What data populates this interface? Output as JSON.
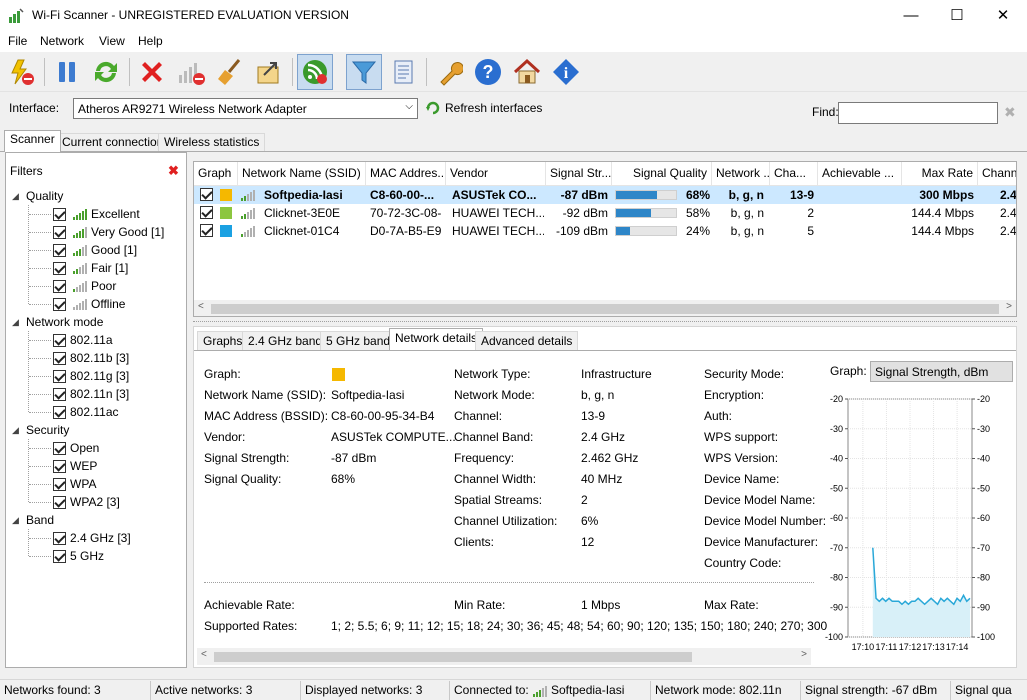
{
  "window": {
    "title": "Wi-Fi Scanner - UNREGISTERED EVALUATION VERSION",
    "min": "—",
    "max": "☐",
    "close": "✕"
  },
  "menu": [
    "File",
    "Network",
    "View",
    "Help"
  ],
  "toolbar": {
    "icons": [
      "power-off-icon",
      "pause-icon",
      "refresh-icon",
      "delete-icon",
      "signal-off-icon",
      "broom-icon",
      "export-icon",
      "rss-icon",
      "filter-icon",
      "notebook-icon",
      "wrench-icon",
      "help-icon",
      "home-icon",
      "info-icon"
    ],
    "active": [
      "rss-icon",
      "filter-icon"
    ]
  },
  "interface": {
    "label": "Interface:",
    "value": "Atheros AR9271 Wireless Network Adapter",
    "refresh": "Refresh interfaces",
    "find_label": "Find:",
    "find_value": ""
  },
  "tabs": [
    "Scanner",
    "Current connection",
    "Wireless statistics"
  ],
  "filters": {
    "title": "Filters",
    "groups": [
      {
        "name": "Quality",
        "items": [
          {
            "label": "Excellent",
            "bars": 5
          },
          {
            "label": "Very Good [1]",
            "bars": 4
          },
          {
            "label": "Good [1]",
            "bars": 3
          },
          {
            "label": "Fair [1]",
            "bars": 2
          },
          {
            "label": "Poor",
            "bars": 1
          },
          {
            "label": "Offline",
            "bars": 0
          }
        ]
      },
      {
        "name": "Network mode",
        "items": [
          {
            "label": "802.11a"
          },
          {
            "label": "802.11b [3]"
          },
          {
            "label": "802.11g [3]"
          },
          {
            "label": "802.11n [3]"
          },
          {
            "label": "802.11ac"
          }
        ]
      },
      {
        "name": "Security",
        "items": [
          {
            "label": "Open"
          },
          {
            "label": "WEP"
          },
          {
            "label": "WPA"
          },
          {
            "label": "WPA2 [3]"
          }
        ]
      },
      {
        "name": "Band",
        "items": [
          {
            "label": "2.4 GHz [3]"
          },
          {
            "label": "5 GHz"
          }
        ]
      }
    ]
  },
  "table": {
    "columns": [
      "Graph",
      "Network Name (SSID)",
      "MAC Addres...",
      "Vendor",
      "Signal Str...",
      "Signal Quality",
      "Network ...",
      "Cha...",
      "Achievable ...",
      "Max Rate",
      "Chann"
    ],
    "rows": [
      {
        "color": "#f5b800",
        "ssid": "Softpedia-Iasi",
        "mac": "C8-60-00-...",
        "vendor": "ASUSTek CO...",
        "signal": "-87 dBm",
        "quality": "68%",
        "quality_value": 68,
        "mode": "b, g, n",
        "channel": "13-9",
        "rate": "300 Mbps",
        "chann": "2.4",
        "bars": 2,
        "bold": true
      },
      {
        "color": "#8cc63f",
        "ssid": "Clicknet-3E0E",
        "mac": "70-72-3C-08-...",
        "vendor": "HUAWEI TECH...",
        "signal": "-92 dBm",
        "quality": "58%",
        "quality_value": 58,
        "mode": "b, g, n",
        "channel": "2",
        "rate": "144.4 Mbps",
        "chann": "2.4",
        "bars": 2,
        "bold": false
      },
      {
        "color": "#1ba1e2",
        "ssid": "Clicknet-01C4",
        "mac": "D0-7A-B5-E9...",
        "vendor": "HUAWEI TECH...",
        "signal": "-109 dBm",
        "quality": "24%",
        "quality_value": 24,
        "mode": "b, g, n",
        "channel": "5",
        "rate": "144.4 Mbps",
        "chann": "2.4",
        "bars": 1,
        "bold": false
      }
    ]
  },
  "detail_tabs": [
    "Graphs",
    "2.4 GHz band",
    "5 GHz band",
    "Network details",
    "Advanced details"
  ],
  "details": {
    "col1": [
      {
        "k": "Graph:",
        "v": ""
      },
      {
        "k": "Network Name (SSID):",
        "v": "Softpedia-Iasi"
      },
      {
        "k": "MAC Address (BSSID):",
        "v": "C8-60-00-95-34-B4"
      },
      {
        "k": "Vendor:",
        "v": "ASUSTek COMPUTE..."
      },
      {
        "k": "Signal Strength:",
        "v": "-87 dBm"
      },
      {
        "k": "Signal Quality:",
        "v": "68%"
      }
    ],
    "col2": [
      {
        "k": "Network Type:",
        "v": "Infrastructure"
      },
      {
        "k": "Network Mode:",
        "v": "b, g, n"
      },
      {
        "k": "Channel:",
        "v": "13-9"
      },
      {
        "k": "Channel Band:",
        "v": "2.4 GHz"
      },
      {
        "k": "Frequency:",
        "v": "2.462 GHz"
      },
      {
        "k": "Channel Width:",
        "v": "40 MHz"
      },
      {
        "k": "Spatial Streams:",
        "v": "2"
      },
      {
        "k": "Channel Utilization:",
        "v": "6%"
      },
      {
        "k": "Clients:",
        "v": "12"
      }
    ],
    "col3": [
      "Security Mode:",
      "Encryption:",
      "Auth:",
      "WPS support:",
      "WPS Version:",
      "Device Name:",
      "Device Model Name:",
      "Device Model Number:",
      "Device Manufacturer:",
      "Country Code:"
    ],
    "achievable": "Achievable Rate:",
    "min_rate_label": "Min Rate:",
    "min_rate": "1 Mbps",
    "max_rate_label": "Max Rate:",
    "supported_label": "Supported Rates:",
    "supported": "1; 2; 5.5; 6; 9; 11; 12; 15; 18; 24; 30; 36; 45; 48; 54; 60; 90; 120; 135; 150; 180; 240; 270; 300"
  },
  "graph": {
    "label": "Graph:",
    "select": "Signal Strength, dBm"
  },
  "chart_data": {
    "type": "area",
    "title": "",
    "ylabel": "",
    "ylim": [
      -100,
      -20
    ],
    "yticks": [
      -20,
      -30,
      -40,
      -50,
      -60,
      -70,
      -80,
      -90,
      -100
    ],
    "xticks": [
      "17:10",
      "17:11",
      "17:12",
      "17:13",
      "17:14"
    ],
    "series": [
      {
        "values": [
          -70,
          -87,
          -88,
          -87,
          -88,
          -87,
          -88,
          -88,
          -88,
          -89,
          -88,
          -89,
          -88,
          -88,
          -87,
          -88,
          -89,
          -88,
          -87,
          -88,
          -89,
          -87,
          -88,
          -87,
          -88,
          -89,
          -87,
          -88,
          -86,
          -88,
          -87
        ]
      }
    ]
  },
  "statusbar": {
    "found": "Networks found: 3",
    "active": "Active networks: 3",
    "displayed": "Displayed networks: 3",
    "connected_label": "Connected to:",
    "connected": "Softpedia-Iasi",
    "mode": "Network mode: 802.11n",
    "strength": "Signal strength: -67 dBm",
    "quality": "Signal qua"
  }
}
